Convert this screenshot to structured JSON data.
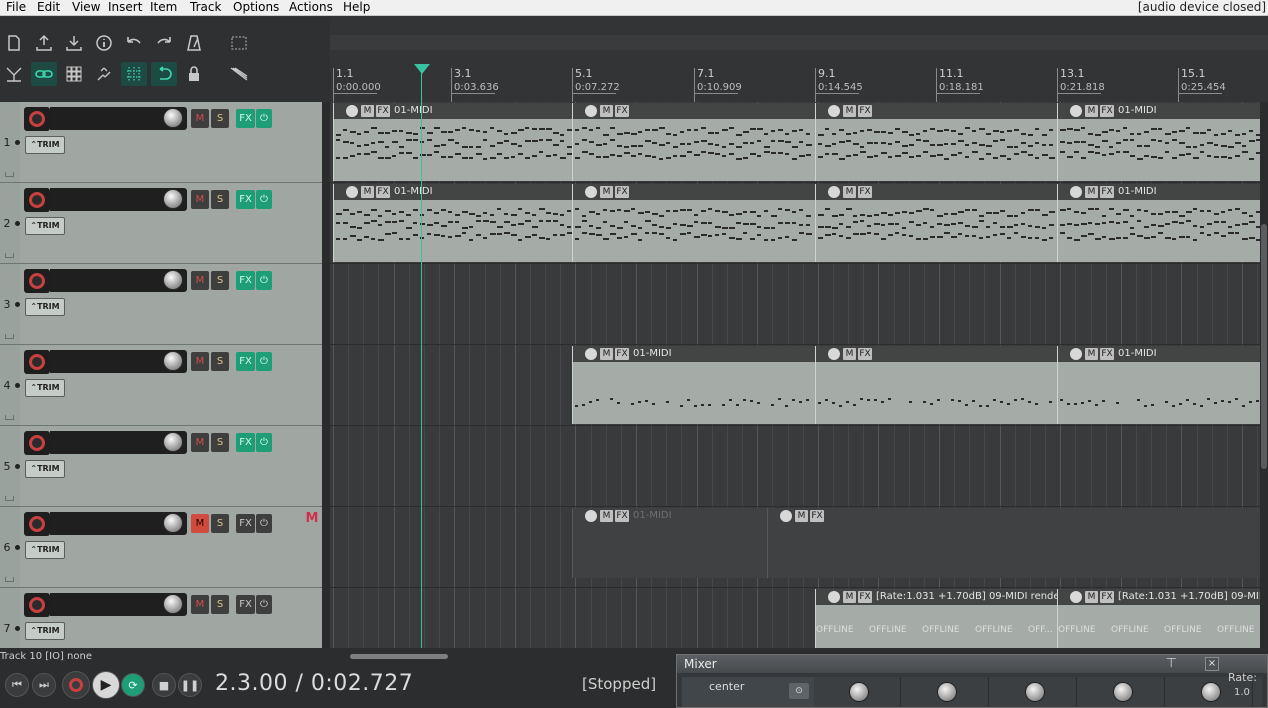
{
  "menu": {
    "items": [
      "File",
      "Edit",
      "View",
      "Insert",
      "Item",
      "Track",
      "Options",
      "Actions",
      "Help"
    ],
    "status": "[audio device closed]"
  },
  "toolbar": {
    "row1": [
      "new-project-icon",
      "open-project-icon",
      "save-project-icon",
      "project-info-icon",
      "undo-icon",
      "redo-icon",
      "metronome-icon",
      "screenset-icon"
    ],
    "row2": [
      "ripple-edit-icon",
      "link-icon",
      "grid-icon",
      "snap-icon",
      "grid-lines-icon",
      "loop-icon",
      "lock-icon",
      "envelope-icon"
    ]
  },
  "ruler": {
    "marks": [
      {
        "bar": "1.1",
        "time": "0:00.000"
      },
      {
        "bar": "3.1",
        "time": "0:03.636"
      },
      {
        "bar": "5.1",
        "time": "0:07.272"
      },
      {
        "bar": "7.1",
        "time": "0:10.909"
      },
      {
        "bar": "9.1",
        "time": "0:14.545"
      },
      {
        "bar": "11.1",
        "time": "0:18.181"
      },
      {
        "bar": "13.1",
        "time": "0:21.818"
      },
      {
        "bar": "15.1",
        "time": "0:25.454"
      }
    ]
  },
  "tracks": [
    {
      "num": "1",
      "mute": "M",
      "solo": "S",
      "fx": "FX",
      "trim": "TRIM",
      "muted": false,
      "fx_on": true
    },
    {
      "num": "2",
      "mute": "M",
      "solo": "S",
      "fx": "FX",
      "trim": "TRIM",
      "muted": false,
      "fx_on": true
    },
    {
      "num": "3",
      "mute": "M",
      "solo": "S",
      "fx": "FX",
      "trim": "TRIM",
      "muted": false,
      "fx_on": true
    },
    {
      "num": "4",
      "mute": "M",
      "solo": "S",
      "fx": "FX",
      "trim": "TRIM",
      "muted": false,
      "fx_on": true
    },
    {
      "num": "5",
      "mute": "M",
      "solo": "S",
      "fx": "FX",
      "trim": "TRIM",
      "muted": false,
      "fx_on": true
    },
    {
      "num": "6",
      "mute": "M",
      "solo": "S",
      "fx": "FX",
      "trim": "TRIM",
      "muted": true,
      "fx_on": false
    },
    {
      "num": "7",
      "mute": "M",
      "solo": "S",
      "fx": "FX",
      "trim": "TRIM",
      "muted": false,
      "fx_on": false
    }
  ],
  "mute_indicator": "M",
  "items": {
    "midi": "01-MIDI",
    "item_m": "M",
    "item_fx": "FX",
    "render_a": "[Rate:1.031 +1.70dB] 09-MIDI render...",
    "render_b": "[Rate:1.031 +1.70dB] 09-MIDI r",
    "offline": "OFFLINE",
    "offline_cut": "OFF..."
  },
  "status": {
    "track": "Track 10 [IO] none",
    "time": "2.3.00 / 0:02.727",
    "state": "[Stopped]"
  },
  "mixer": {
    "title": "Mixer",
    "close": "×",
    "pan": "center",
    "rate_label": "Rate:",
    "rate_value": "1.0"
  },
  "colors": {
    "fx_active": "#1e9e76",
    "mute_active": "#d04a3e",
    "playhead": "#37c2a0",
    "item_bg": "#a5aca8"
  }
}
